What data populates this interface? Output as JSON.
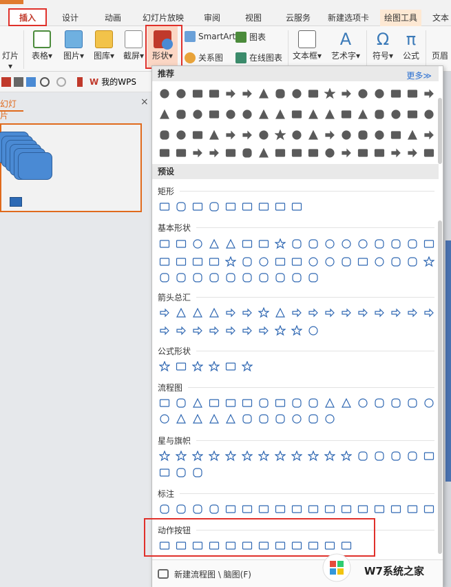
{
  "tabs": [
    "插入",
    "设计",
    "动画",
    "幻灯片放映",
    "审阅",
    "视图",
    "云服务",
    "新建选项卡",
    "绘图工具",
    "文本"
  ],
  "ribbon": {
    "left_label": "灯片",
    "table": "表格",
    "picture": "图片",
    "gallery": "图库",
    "screenshot": "截屏",
    "shape": "形状",
    "smartart": "SmartArt",
    "chart": "图表",
    "relation": "关系图",
    "online_chart": "在线图表",
    "textbox": "文本框",
    "wordart": "艺术字",
    "symbol": "符号",
    "formula": "公式",
    "header": "页眉"
  },
  "quick": {
    "mywps": "我的WPS"
  },
  "left_panel": {
    "title": "幻灯片",
    "close": "×"
  },
  "dropdown": {
    "recommend": "推荐",
    "more": "更多≫",
    "preset": "预设",
    "categories": [
      "矩形",
      "基本形状",
      "箭头总汇",
      "公式形状",
      "流程图",
      "星与旗帜",
      "标注",
      "动作按钮"
    ],
    "footer": "新建流程图 \\ 脑图(F)"
  },
  "watermark": {
    "text": "W7系统之家"
  },
  "colors": {
    "accent": "#e0302a",
    "orange": "#e06a1c",
    "shape_fill": "#4a8ad4",
    "outline": "#2f67b2"
  }
}
